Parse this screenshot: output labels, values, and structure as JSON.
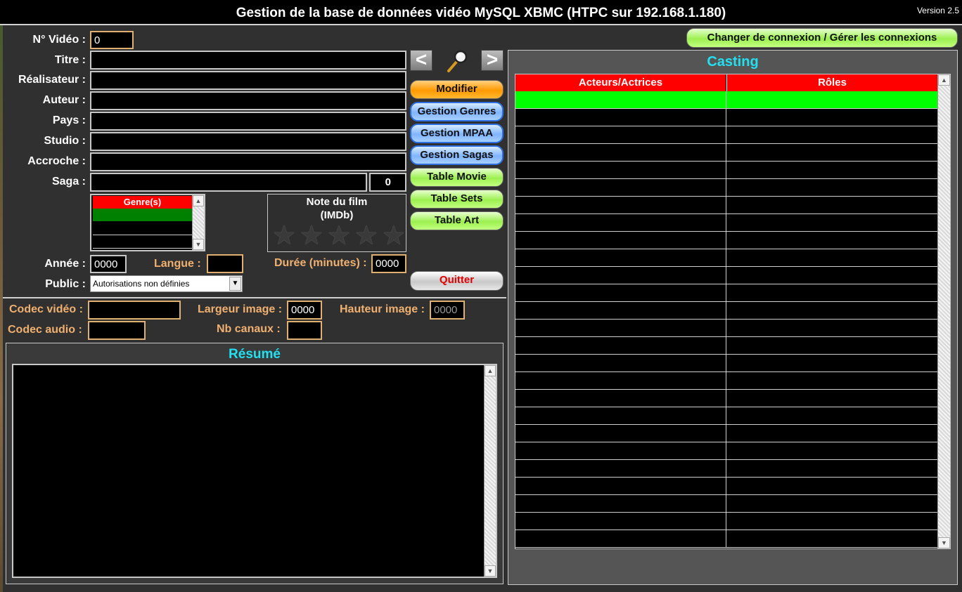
{
  "app": {
    "title": "Gestion de la base de données vidéo MySQL XBMC (HTPC sur 192.168.1.180)",
    "version": "Version 2.5"
  },
  "connection_button": "Changer de connexion / Gérer les connexions",
  "form": {
    "no_video": {
      "label": "N° Vidéo :",
      "value": "0"
    },
    "titre": {
      "label": "Titre :",
      "value": ""
    },
    "realisateur": {
      "label": "Réalisateur :",
      "value": ""
    },
    "auteur": {
      "label": "Auteur :",
      "value": ""
    },
    "pays": {
      "label": "Pays :",
      "value": ""
    },
    "studio": {
      "label": "Studio :",
      "value": ""
    },
    "accroche": {
      "label": "Accroche :",
      "value": ""
    },
    "saga": {
      "label": "Saga :",
      "value": "",
      "number": "0"
    },
    "genres": {
      "header": "Genre(s)"
    },
    "note": {
      "label": "Note du film",
      "sublabel": "(IMDb)",
      "stars": 0,
      "max_stars": 5
    },
    "annee": {
      "label": "Année :",
      "value": "0000"
    },
    "langue": {
      "label": "Langue :",
      "value": ""
    },
    "duree": {
      "label": "Durée (minutes) :",
      "value": "0000"
    },
    "public": {
      "label": "Public :",
      "value": "Autorisations non définies"
    },
    "codec_video": {
      "label": "Codec vidéo :",
      "value": ""
    },
    "largeur": {
      "label": "Largeur image :",
      "value": "0000"
    },
    "hauteur": {
      "label": "Hauteur image :",
      "value": "0000"
    },
    "codec_audio": {
      "label": "Codec audio :",
      "value": ""
    },
    "nb_canaux": {
      "label": "Nb canaux :",
      "value": ""
    }
  },
  "nav": {
    "prev": "<",
    "next": ">"
  },
  "buttons": {
    "modifier": "Modifier",
    "gestion_genres": "Gestion Genres",
    "gestion_mpaa": "Gestion MPAA",
    "gestion_sagas": "Gestion Sagas",
    "table_movie": "Table Movie",
    "table_sets": "Table Sets",
    "table_art": "Table Art",
    "quitter": "Quitter"
  },
  "resume": {
    "title": "Résumé",
    "text": ""
  },
  "casting": {
    "title": "Casting",
    "columns": [
      "Acteurs/Actrices",
      "Rôles"
    ],
    "row_count": 26
  },
  "colors": {
    "accent_orange": "#f0b070",
    "casting_title": "#22e0f0",
    "header_red": "#ff0000",
    "selected_green": "#00ff00",
    "genre_selected": "#008000"
  }
}
